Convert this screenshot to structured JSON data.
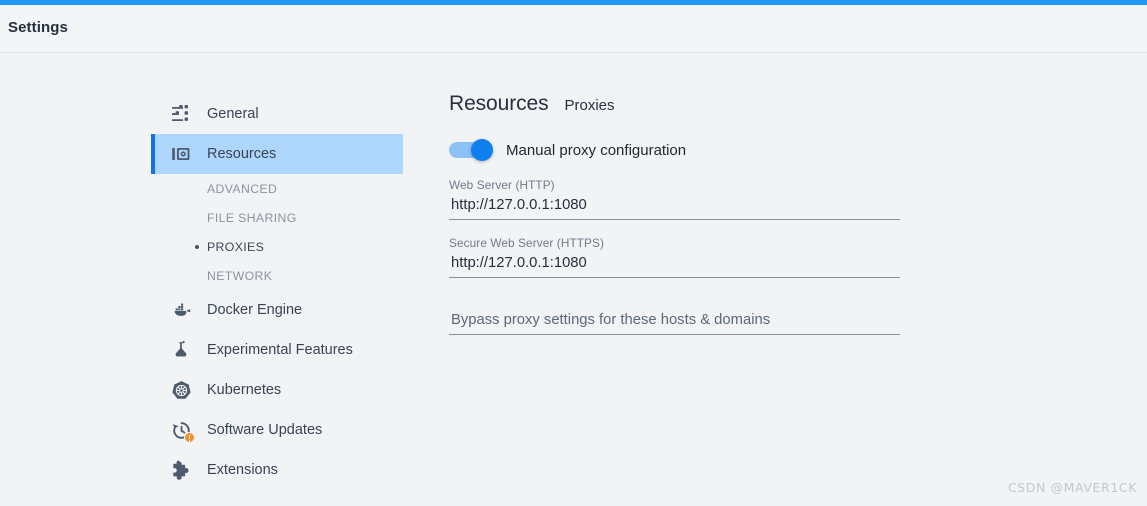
{
  "window": {
    "title": "Settings",
    "accent_color": "#2196f3"
  },
  "sidebar": {
    "items": [
      {
        "label": "General",
        "icon": "sliders-icon",
        "selected": false
      },
      {
        "label": "Resources",
        "icon": "resources-chip-icon",
        "selected": true
      },
      {
        "label": "Docker Engine",
        "icon": "docker-whale-icon",
        "selected": false
      },
      {
        "label": "Experimental Features",
        "icon": "flask-icon",
        "selected": false
      },
      {
        "label": "Kubernetes",
        "icon": "kubernetes-helm-icon",
        "selected": false
      },
      {
        "label": "Software Updates",
        "icon": "update-clock-icon",
        "selected": false,
        "badge": "alert"
      },
      {
        "label": "Extensions",
        "icon": "puzzle-piece-icon",
        "selected": false
      }
    ],
    "subitems": [
      {
        "label": "ADVANCED",
        "active": false
      },
      {
        "label": "FILE SHARING",
        "active": false
      },
      {
        "label": "PROXIES",
        "active": true
      },
      {
        "label": "NETWORK",
        "active": false
      }
    ],
    "selected_color": "#aed6fc",
    "selected_marker_color": "#1273e6"
  },
  "main": {
    "heading": "Resources",
    "subheading": "Proxies",
    "toggle": {
      "label": "Manual proxy configuration",
      "enabled": true,
      "on_color": "#0f7ff0",
      "track_color": "#8cc2f6"
    },
    "fields": [
      {
        "label": "Web Server (HTTP)",
        "value": "http://127.0.0.1:1080",
        "is_placeholder": false
      },
      {
        "label": "Secure Web Server (HTTPS)",
        "value": "http://127.0.0.1:1080",
        "is_placeholder": false
      },
      {
        "label": "",
        "value": "Bypass proxy settings for these hosts & domains",
        "is_placeholder": true
      }
    ]
  },
  "watermark": {
    "text": "CSDN @MAVER1CK"
  }
}
